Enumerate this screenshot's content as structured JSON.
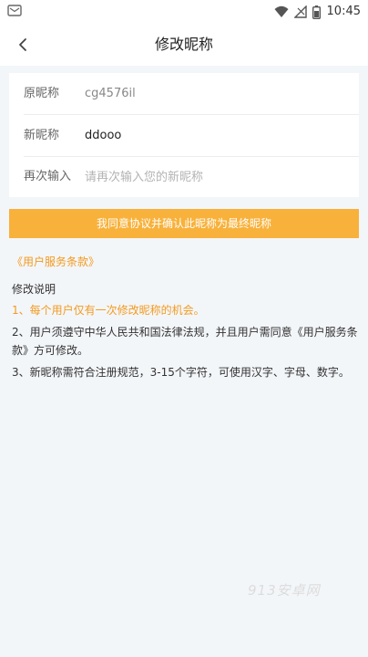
{
  "status_bar": {
    "time": "10:45",
    "icons": [
      "notification-icon",
      "wifi-icon",
      "no-sim-icon",
      "battery-icon"
    ]
  },
  "nav": {
    "back_icon": "chevron-left-icon",
    "title": "修改昵称"
  },
  "form": {
    "original": {
      "label": "原昵称",
      "value": "cg4576il"
    },
    "new_name": {
      "label": "新昵称",
      "value": "ddooo",
      "placeholder": ""
    },
    "confirm": {
      "label": "再次输入",
      "value": "",
      "placeholder": "请再次输入您的新昵称"
    }
  },
  "submit_button": {
    "label": "我同意协议并确认此昵称为最终昵称",
    "color": "#f8b13a"
  },
  "terms_link": "《用户服务条款》",
  "notes": {
    "title": "修改说明",
    "items": [
      "1、每个用户仅有一次修改昵称的机会。",
      "2、用户须遵守中华人民共和国法律法规，并且用户需同意《用户服务条款》方可修改。",
      "3、新昵称需符合注册规范，3-15个字符，可使用汉字、字母、数字。"
    ]
  },
  "watermark": "913安卓网",
  "colors": {
    "accent": "#f39a1e",
    "background": "#f3f6f9"
  }
}
